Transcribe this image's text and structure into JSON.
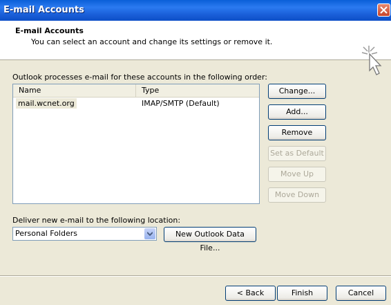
{
  "window": {
    "title": "E-mail Accounts"
  },
  "header": {
    "title": "E-mail Accounts",
    "subtitle": "You can select an account and change its settings or remove it.",
    "icon": "wizard-sparkle-cursor-icon"
  },
  "accounts": {
    "label": "Outlook processes e-mail for these accounts in the following order:",
    "columns": [
      "Name",
      "Type"
    ],
    "rows": [
      {
        "name": "mail.wcnet.org",
        "type": "IMAP/SMTP (Default)"
      }
    ]
  },
  "side_buttons": {
    "change": "Change...",
    "add": "Add...",
    "remove": "Remove",
    "set_default": "Set as Default",
    "move_up": "Move Up",
    "move_down": "Move Down"
  },
  "deliver": {
    "label": "Deliver new e-mail to the following location:",
    "selected": "Personal Folders",
    "new_data_file": "New Outlook Data File..."
  },
  "footer": {
    "back": "< Back",
    "finish": "Finish",
    "cancel": "Cancel"
  },
  "colors": {
    "titlebar": "#0a5fd8",
    "dialog_bg": "#ece9d8",
    "button_border": "#003c74",
    "list_border": "#7f9db9"
  }
}
